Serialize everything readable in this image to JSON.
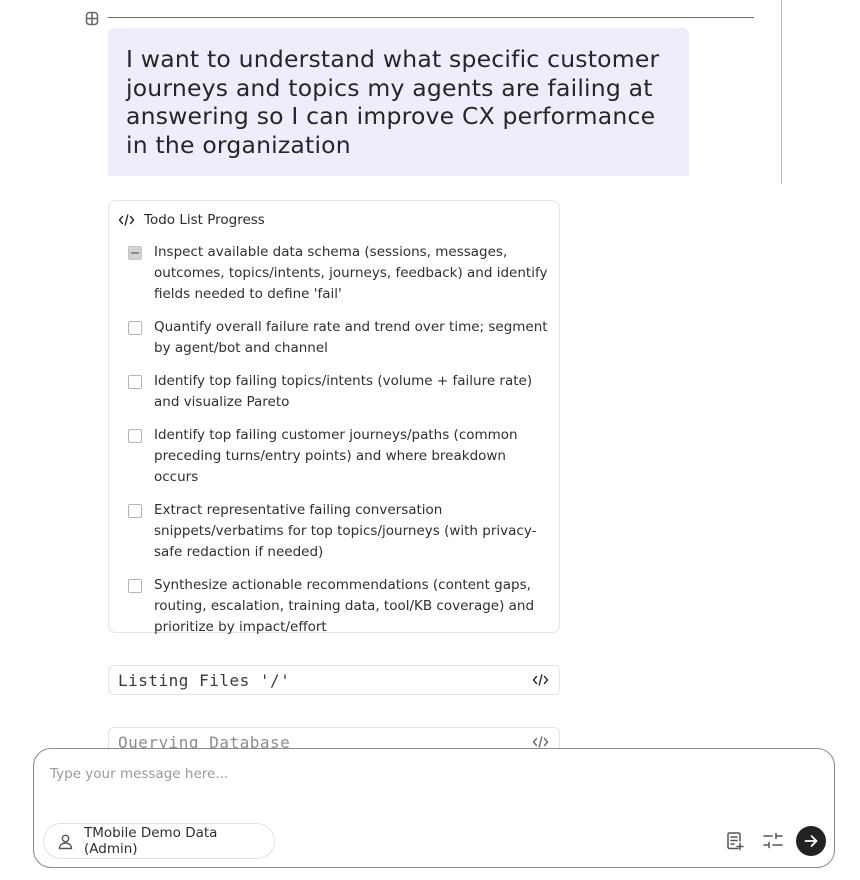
{
  "conversation": {
    "user_message": "I want to understand what specific customer journeys and topics my agents are failing at answering so I can improve CX performance in the organization"
  },
  "todo": {
    "title": "Todo List Progress",
    "items": [
      {
        "label": "Inspect available data schema (sessions, messages, outcomes, topics/intents, journeys, feedback) and identify fields needed to define 'fail'",
        "status": "in-progress"
      },
      {
        "label": "Quantify overall failure rate and trend over time; segment by agent/bot and channel",
        "status": "pending"
      },
      {
        "label": "Identify top failing topics/intents (volume + failure rate) and visualize Pareto",
        "status": "pending"
      },
      {
        "label": "Identify top failing customer journeys/paths (common preceding turns/entry points) and where breakdown occurs",
        "status": "pending"
      },
      {
        "label": "Extract representative failing conversation snippets/verbatims for top topics/journeys (with privacy-safe redaction if needed)",
        "status": "pending"
      },
      {
        "label": "Synthesize actionable recommendations (content gaps, routing, escalation, training data, tool/KB coverage) and prioritize by impact/effort",
        "status": "pending"
      }
    ]
  },
  "tool_calls": [
    {
      "label": "Listing Files '/'",
      "icon": "code-icon"
    },
    {
      "label": "Querying Database",
      "icon": "code-icon"
    }
  ],
  "composer": {
    "placeholder": "Type your message here...",
    "data_source_label": "TMobile Demo Data (Admin)",
    "icons": [
      "person-icon",
      "document-add-icon",
      "sliders-icon",
      "arrow-right-icon"
    ]
  },
  "colors": {
    "user_bubble": "#efedfb",
    "send_button": "#222222"
  }
}
